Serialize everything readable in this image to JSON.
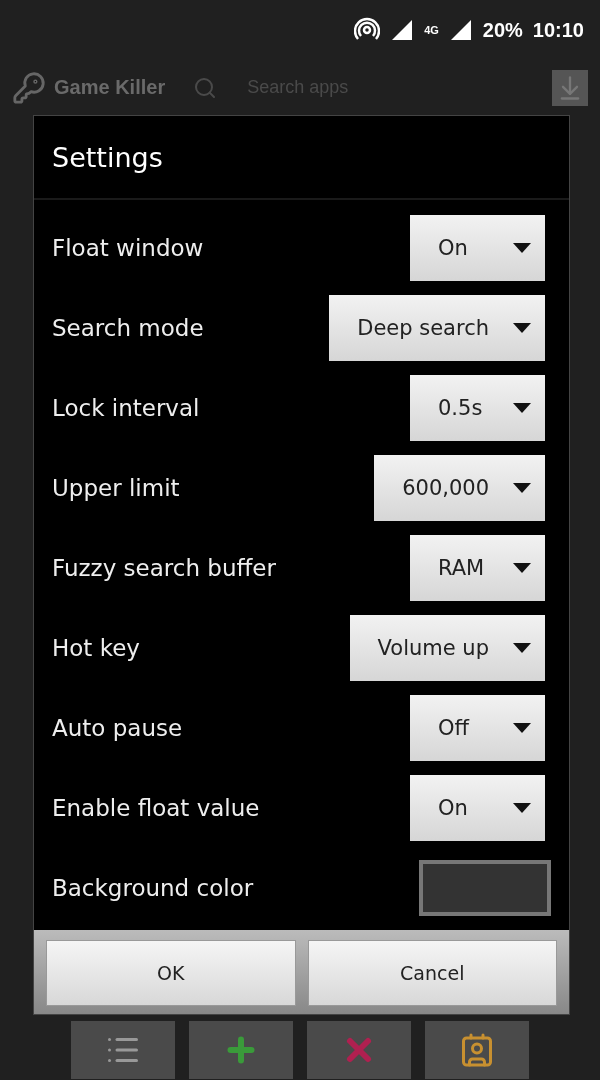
{
  "status_bar": {
    "network": "4G",
    "battery": "20%",
    "time": "10:10"
  },
  "app": {
    "title": "Game Killer",
    "search": {
      "placeholder": "Search apps"
    }
  },
  "dialog": {
    "title": "Settings",
    "rows": [
      {
        "kind": "dropdown",
        "label": "Float window",
        "value": "On"
      },
      {
        "kind": "dropdown",
        "label": "Search mode",
        "value": "Deep search"
      },
      {
        "kind": "dropdown",
        "label": "Lock interval",
        "value": "0.5s"
      },
      {
        "kind": "dropdown",
        "label": "Upper limit",
        "value": "600,000"
      },
      {
        "kind": "dropdown",
        "label": "Fuzzy search buffer",
        "value": "RAM"
      },
      {
        "kind": "dropdown",
        "label": "Hot key",
        "value": "Volume up"
      },
      {
        "kind": "dropdown",
        "label": "Auto pause",
        "value": "Off"
      },
      {
        "kind": "dropdown",
        "label": "Enable float value",
        "value": "On"
      },
      {
        "kind": "color",
        "label": "Background color",
        "color": "#333333"
      }
    ],
    "buttons": [
      "OK",
      "Cancel"
    ]
  }
}
